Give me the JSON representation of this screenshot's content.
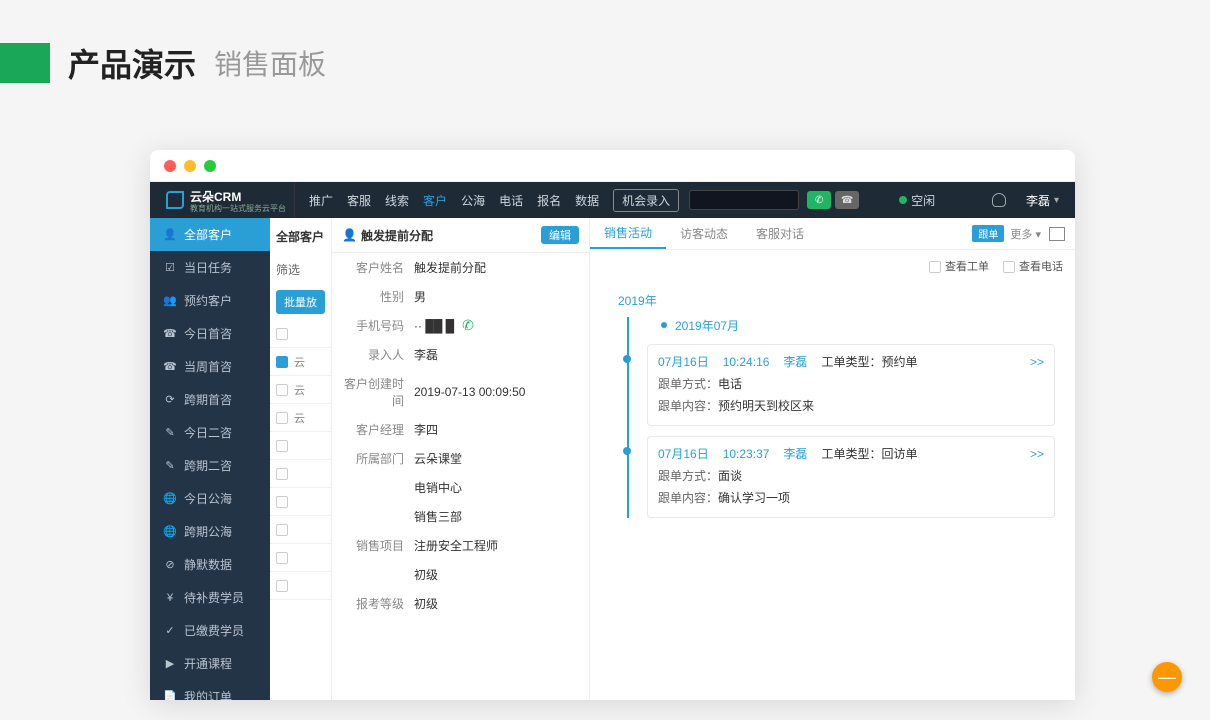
{
  "page": {
    "title_main": "产品演示",
    "title_sub": "销售面板"
  },
  "topnav": {
    "brand": "云朵CRM",
    "brand_sub": "教育机构一站式服务云平台",
    "items": [
      "推广",
      "客服",
      "线索",
      "客户",
      "公海",
      "电话",
      "报名",
      "数据"
    ],
    "active_index": 3,
    "opportunity_btn": "机会录入",
    "status_label": "空闲",
    "user_name": "李磊"
  },
  "sidebar": {
    "items": [
      {
        "icon": "👤",
        "label": "全部客户"
      },
      {
        "icon": "☑",
        "label": "当日任务"
      },
      {
        "icon": "👥",
        "label": "预约客户"
      },
      {
        "icon": "☎",
        "label": "今日首咨"
      },
      {
        "icon": "☎",
        "label": "当周首咨"
      },
      {
        "icon": "⟳",
        "label": "跨期首咨"
      },
      {
        "icon": "✎",
        "label": "今日二咨"
      },
      {
        "icon": "✎",
        "label": "跨期二咨"
      },
      {
        "icon": "🌐",
        "label": "今日公海"
      },
      {
        "icon": "🌐",
        "label": "跨期公海"
      },
      {
        "icon": "⊘",
        "label": "静默数据"
      },
      {
        "icon": "¥",
        "label": "待补费学员"
      },
      {
        "icon": "✓",
        "label": "已缴费学员"
      },
      {
        "icon": "▶",
        "label": "开通课程"
      },
      {
        "icon": "📄",
        "label": "我的订单"
      }
    ],
    "active_index": 0
  },
  "listcol": {
    "header": "全部客户",
    "filter_label": "筛选",
    "batch_label": "批量放",
    "rows": [
      "",
      "云",
      "云",
      "云",
      "",
      "",
      "",
      "",
      "",
      ""
    ],
    "checked_index": 1
  },
  "detail": {
    "title_prefix_icon": "👤",
    "title": "触发提前分配",
    "edit_btn": "编辑",
    "fields": [
      {
        "label": "客户姓名",
        "value": "触发提前分配"
      },
      {
        "label": "性别",
        "value": "男"
      },
      {
        "label": "手机号码",
        "value": "·· ██ █",
        "phone": true
      },
      {
        "label": "录入人",
        "value": "李磊"
      },
      {
        "label": "客户创建时间",
        "value": "2019-07-13 00:09:50"
      },
      {
        "label": "客户经理",
        "value": "李四"
      },
      {
        "label": "所属部门",
        "value": "云朵课堂"
      },
      {
        "label": "",
        "value": "电销中心"
      },
      {
        "label": "",
        "value": "销售三部"
      },
      {
        "label": "销售项目",
        "value": "注册安全工程师"
      },
      {
        "label": "",
        "value": "初级"
      },
      {
        "label": "报考等级",
        "value": "初级"
      }
    ]
  },
  "activity": {
    "tabs": [
      "销售活动",
      "访客动态",
      "客服对话"
    ],
    "active_tab": 0,
    "badge": "跟单",
    "more": "更多 ▾",
    "check1": "查看工单",
    "check2": "查看电话",
    "year": "2019年",
    "month": "2019年07月",
    "entries": [
      {
        "date": "07月16日",
        "time": "10:24:16",
        "user": "李磊",
        "type_label": "工单类型：",
        "type_value": "预约单",
        "rows": [
          {
            "label": "跟单方式：",
            "value": "电话"
          },
          {
            "label": "跟单内容：",
            "value": "预约明天到校区来"
          }
        ],
        "expand": ">>"
      },
      {
        "date": "07月16日",
        "time": "10:23:37",
        "user": "李磊",
        "type_label": "工单类型：",
        "type_value": "回访单",
        "rows": [
          {
            "label": "跟单方式：",
            "value": "面谈"
          },
          {
            "label": "跟单内容：",
            "value": "确认学习一项"
          }
        ],
        "expand": ">>"
      }
    ]
  },
  "fab": "—"
}
